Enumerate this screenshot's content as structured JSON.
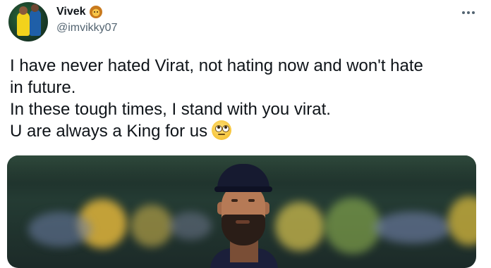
{
  "author": {
    "display_name": "Vivek",
    "handle": "@imvikky07",
    "badge_icon": "lion-face-icon"
  },
  "tweet": {
    "lines": [
      "I have never hated Virat, not hating now and won't hate",
      "in future.",
      "In these tough times, I stand with you virat.",
      "U are always a King for us"
    ],
    "trailing_emoji": "face-with-rolling-eyes-icon"
  },
  "media": {
    "type": "photo",
    "subject": "cricketer-in-cap"
  },
  "colors": {
    "text": "#0f1419",
    "secondary_text": "#536471",
    "background": "#ffffff"
  }
}
